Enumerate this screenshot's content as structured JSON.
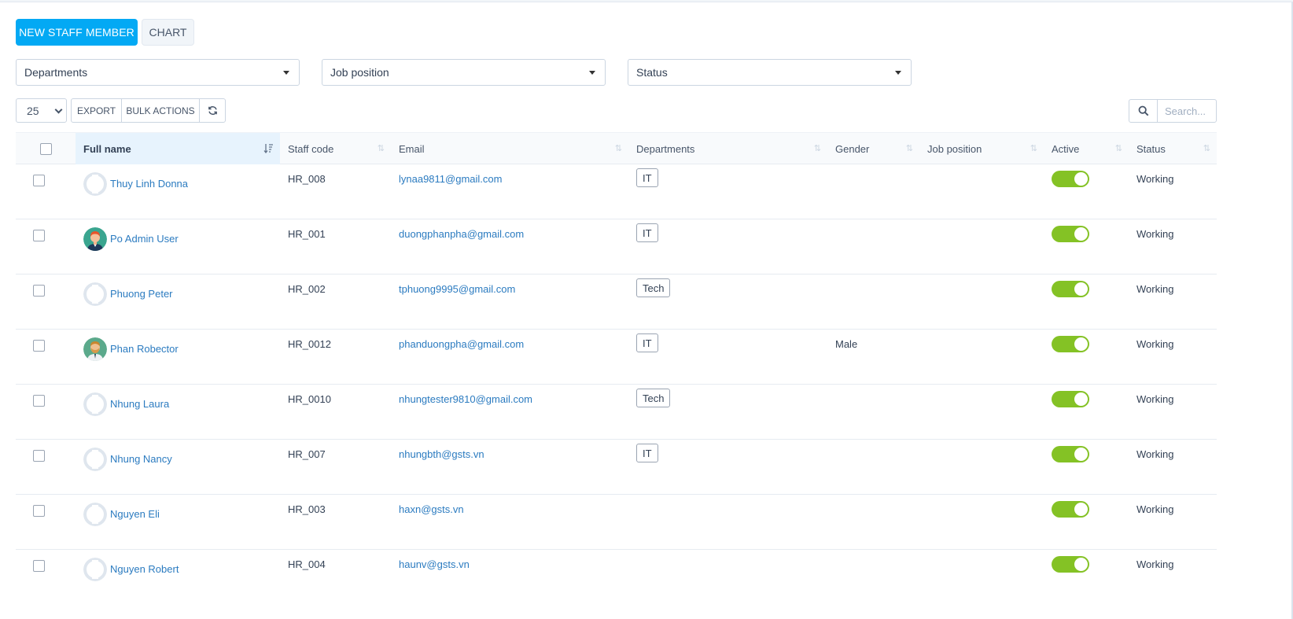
{
  "toolbar": {
    "new_staff_label": "NEW STAFF MEMBER",
    "chart_label": "CHART"
  },
  "filters": {
    "departments": "Departments",
    "job_position": "Job position",
    "status": "Status"
  },
  "table_controls": {
    "page_length": "25",
    "export_label": "EXPORT",
    "bulk_actions_label": "BULK ACTIONS",
    "search_placeholder": "Search..."
  },
  "columns": {
    "full_name": "Full name",
    "staff_code": "Staff code",
    "email": "Email",
    "departments": "Departments",
    "gender": "Gender",
    "job_position": "Job position",
    "active": "Active",
    "status": "Status"
  },
  "rows": [
    {
      "name": "Thuy Linh Donna",
      "code": "HR_008",
      "email": "lynaa9811@gmail.com",
      "dept": "IT",
      "gender": "",
      "job": "",
      "active": true,
      "status": "Working",
      "avatar": "default"
    },
    {
      "name": "Po Admin User",
      "code": "HR_001",
      "email": "duongphanpha@gmail.com",
      "dept": "IT",
      "gender": "",
      "job": "",
      "active": true,
      "status": "Working",
      "avatar": "man-red-hair"
    },
    {
      "name": "Phuong Peter",
      "code": "HR_002",
      "email": "tphuong9995@gmail.com",
      "dept": "Tech",
      "gender": "",
      "job": "",
      "active": true,
      "status": "Working",
      "avatar": "default"
    },
    {
      "name": "Phan Robector",
      "code": "HR_0012",
      "email": "phanduongpha@gmail.com",
      "dept": "IT",
      "gender": "Male",
      "job": "",
      "active": true,
      "status": "Working",
      "avatar": "man-beard"
    },
    {
      "name": "Nhung Laura",
      "code": "HR_0010",
      "email": "nhungtester9810@gmail.com",
      "dept": "Tech",
      "gender": "",
      "job": "",
      "active": true,
      "status": "Working",
      "avatar": "default"
    },
    {
      "name": "Nhung Nancy",
      "code": "HR_007",
      "email": "nhungbth@gsts.vn",
      "dept": "IT",
      "gender": "",
      "job": "",
      "active": true,
      "status": "Working",
      "avatar": "default"
    },
    {
      "name": "Nguyen Eli",
      "code": "HR_003",
      "email": "haxn@gsts.vn",
      "dept": "",
      "gender": "",
      "job": "",
      "active": true,
      "status": "Working",
      "avatar": "default"
    },
    {
      "name": "Nguyen Robert",
      "code": "HR_004",
      "email": "haunv@gsts.vn",
      "dept": "",
      "gender": "",
      "job": "",
      "active": true,
      "status": "Working",
      "avatar": "default"
    }
  ],
  "colors": {
    "primary": "#03a9f4",
    "link": "#2b7bc0",
    "toggle_on": "#84c225",
    "sorted_header": "#e7f3fd"
  }
}
